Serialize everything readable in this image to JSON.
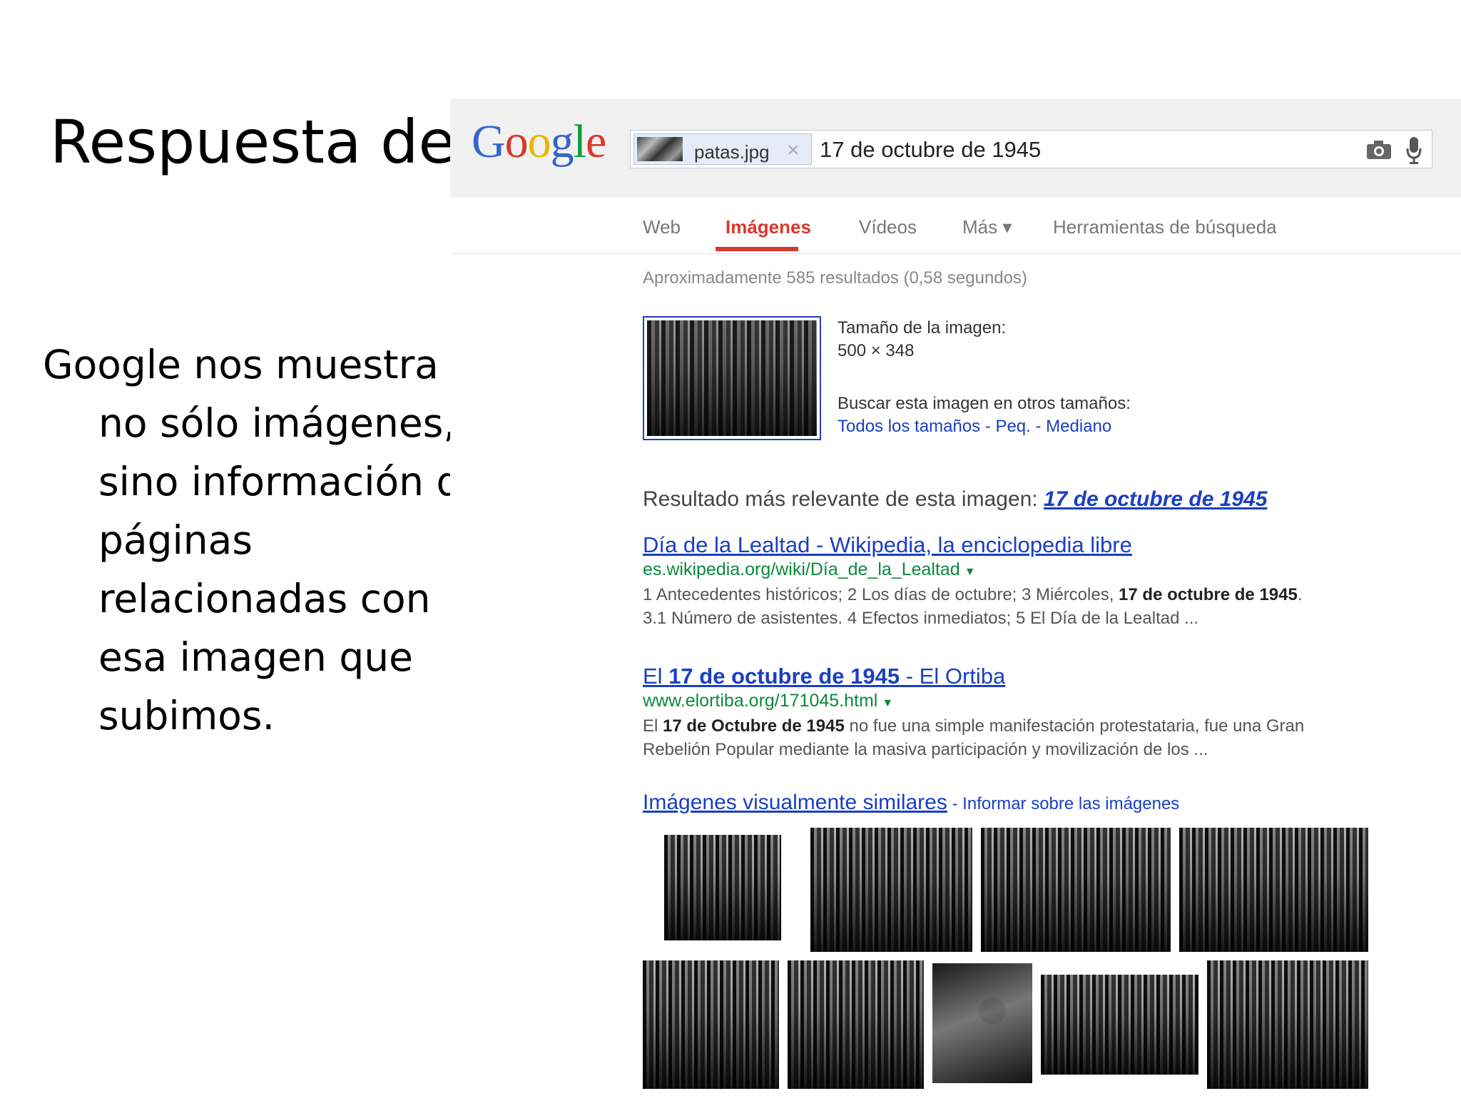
{
  "slide": {
    "title": "Respuesta de",
    "bullet_first": "Google nos muestra",
    "bullet_lines": [
      "no sólo imágenes,",
      "sino información d",
      "páginas",
      "relacionadas con",
      "esa imagen que",
      "subimos."
    ]
  },
  "search": {
    "logo": [
      "G",
      "o",
      "o",
      "g",
      "l",
      "e"
    ],
    "chip_name": "patas.jpg",
    "chip_close": "×",
    "query": "17 de octubre de 1945",
    "camera_icon": "camera-icon",
    "mic_icon": "microphone-icon"
  },
  "tabs": {
    "web": "Web",
    "images": "Imágenes",
    "videos": "Vídeos",
    "more": "Más ▾",
    "tools": "Herramientas de búsqueda"
  },
  "stats": "Aproximadamente 585 resultados (0,58 segundos)",
  "image_info": {
    "size_label": "Tamaño de la imagen:",
    "size_value": "500 × 348",
    "other_sizes_label": "Buscar esta imagen en otros tamaños:",
    "size_all": "Todos los tamaños",
    "sep": " - ",
    "size_small": "Peq.",
    "size_medium": "Mediano"
  },
  "best_guess": {
    "label": "Resultado más relevante de esta imagen: ",
    "link": "17 de octubre de 1945"
  },
  "results": [
    {
      "title": "Día de la Lealtad - Wikipedia, la enciclopedia libre",
      "url": "es.wikipedia.org/wiki/Día_de_la_Lealtad",
      "snippet_1_pre": "1 Antecedentes históricos; 2 Los días de octubre; 3 Miércoles, ",
      "snippet_1_bold": "17 de octubre de 1945",
      "snippet_1_post": ".",
      "snippet_2": "3.1 Número de asistentes. 4 Efectos inmediatos; 5 El Día de la Lealtad ..."
    },
    {
      "title_pre": "El ",
      "title_bold": "17 de octubre de 1945",
      "title_post": " - El Ortiba",
      "url": "www.elortiba.org/171045.html",
      "snippet_1_pre": "El ",
      "snippet_1_bold": "17 de Octubre de 1945",
      "snippet_1_post": " no fue una simple manifestación protestataria, fue una Gran",
      "snippet_2": "Rebelión Popular mediante la masiva participación y movilización de los ..."
    }
  ],
  "similar": {
    "heading": "Imágenes visualmente similares",
    "sep": " - ",
    "report": "Informar sobre las imágenes"
  }
}
